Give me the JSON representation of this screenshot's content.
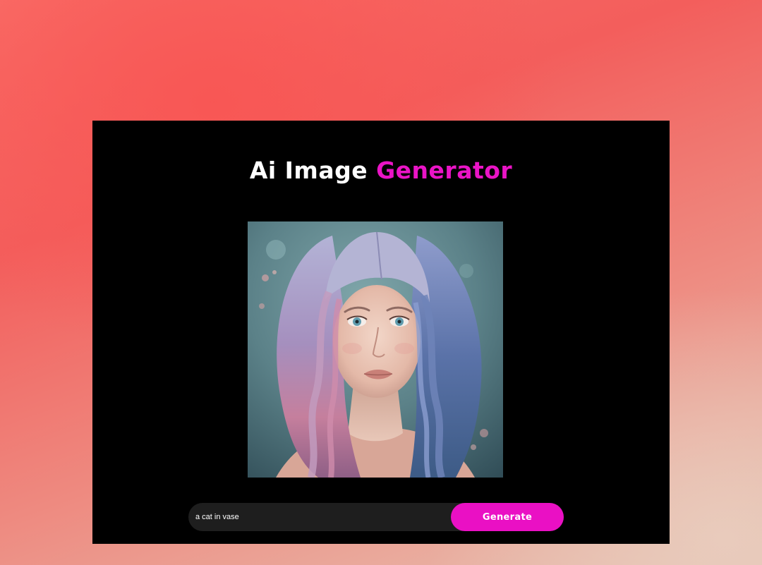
{
  "header": {
    "title_part1": "Ai Image ",
    "title_part2": "Generator"
  },
  "image": {
    "alt": "Generated portrait of a young woman with long wavy lavender, pink and blue hair"
  },
  "prompt": {
    "value": "a cat in vase"
  },
  "actions": {
    "generate_label": "Generate"
  },
  "colors": {
    "accent": "#ea14c6",
    "panel_background": "#000000",
    "input_background": "#1e1e1e",
    "page_gradient_start": "#f8564f",
    "page_gradient_end": "#e6c2b2"
  }
}
